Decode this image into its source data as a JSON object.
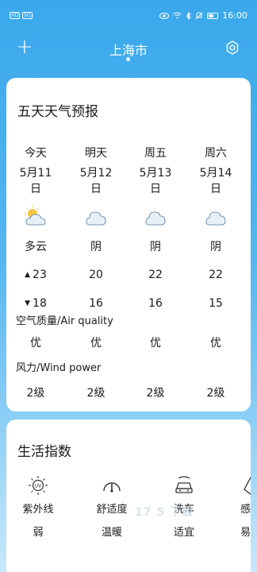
{
  "status_bar": {
    "left_chips": [
      "HD",
      "5G"
    ],
    "time": "16:00",
    "icons": [
      "eye-icon",
      "wifi-icon",
      "bluetooth-icon",
      "mute-icon",
      "battery-icon"
    ]
  },
  "header": {
    "add_label": "+",
    "city": "上海市",
    "settings_icon": "gear-icon"
  },
  "forecast": {
    "title": "五天天气预报",
    "days": [
      {
        "day": "今天",
        "date_line1": "5月11",
        "date_line2": "日",
        "icon": "partly-cloudy-icon",
        "condition": "多云",
        "high": "23",
        "low": "18",
        "air": "优",
        "wind": "2级"
      },
      {
        "day": "明天",
        "date_line1": "5月12",
        "date_line2": "日",
        "icon": "cloudy-icon",
        "condition": "阴",
        "high": "20",
        "low": "16",
        "air": "优",
        "wind": "2级"
      },
      {
        "day": "周五",
        "date_line1": "5月13",
        "date_line2": "日",
        "icon": "cloudy-icon",
        "condition": "阴",
        "high": "22",
        "low": "16",
        "air": "优",
        "wind": "2级"
      },
      {
        "day": "周六",
        "date_line1": "5月14",
        "date_line2": "日",
        "icon": "cloudy-icon",
        "condition": "阴",
        "high": "22",
        "low": "15",
        "air": "优",
        "wind": "2级"
      }
    ],
    "high_arrow": "▲",
    "low_arrow": "▼",
    "air_label": "空气质量/Air quality",
    "wind_label": "风力/Wind power"
  },
  "life": {
    "title": "生活指数",
    "items": [
      {
        "name": "紫外线",
        "value": "弱",
        "icon": "uv-icon"
      },
      {
        "name": "舒适度",
        "value": "温暖",
        "icon": "gauge-icon"
      },
      {
        "name": "洗车",
        "value": "适宜",
        "icon": "car-wash-icon"
      },
      {
        "name": "感",
        "value": "易",
        "icon": "cold-icon"
      }
    ]
  },
  "watermark": "17 5 下载"
}
